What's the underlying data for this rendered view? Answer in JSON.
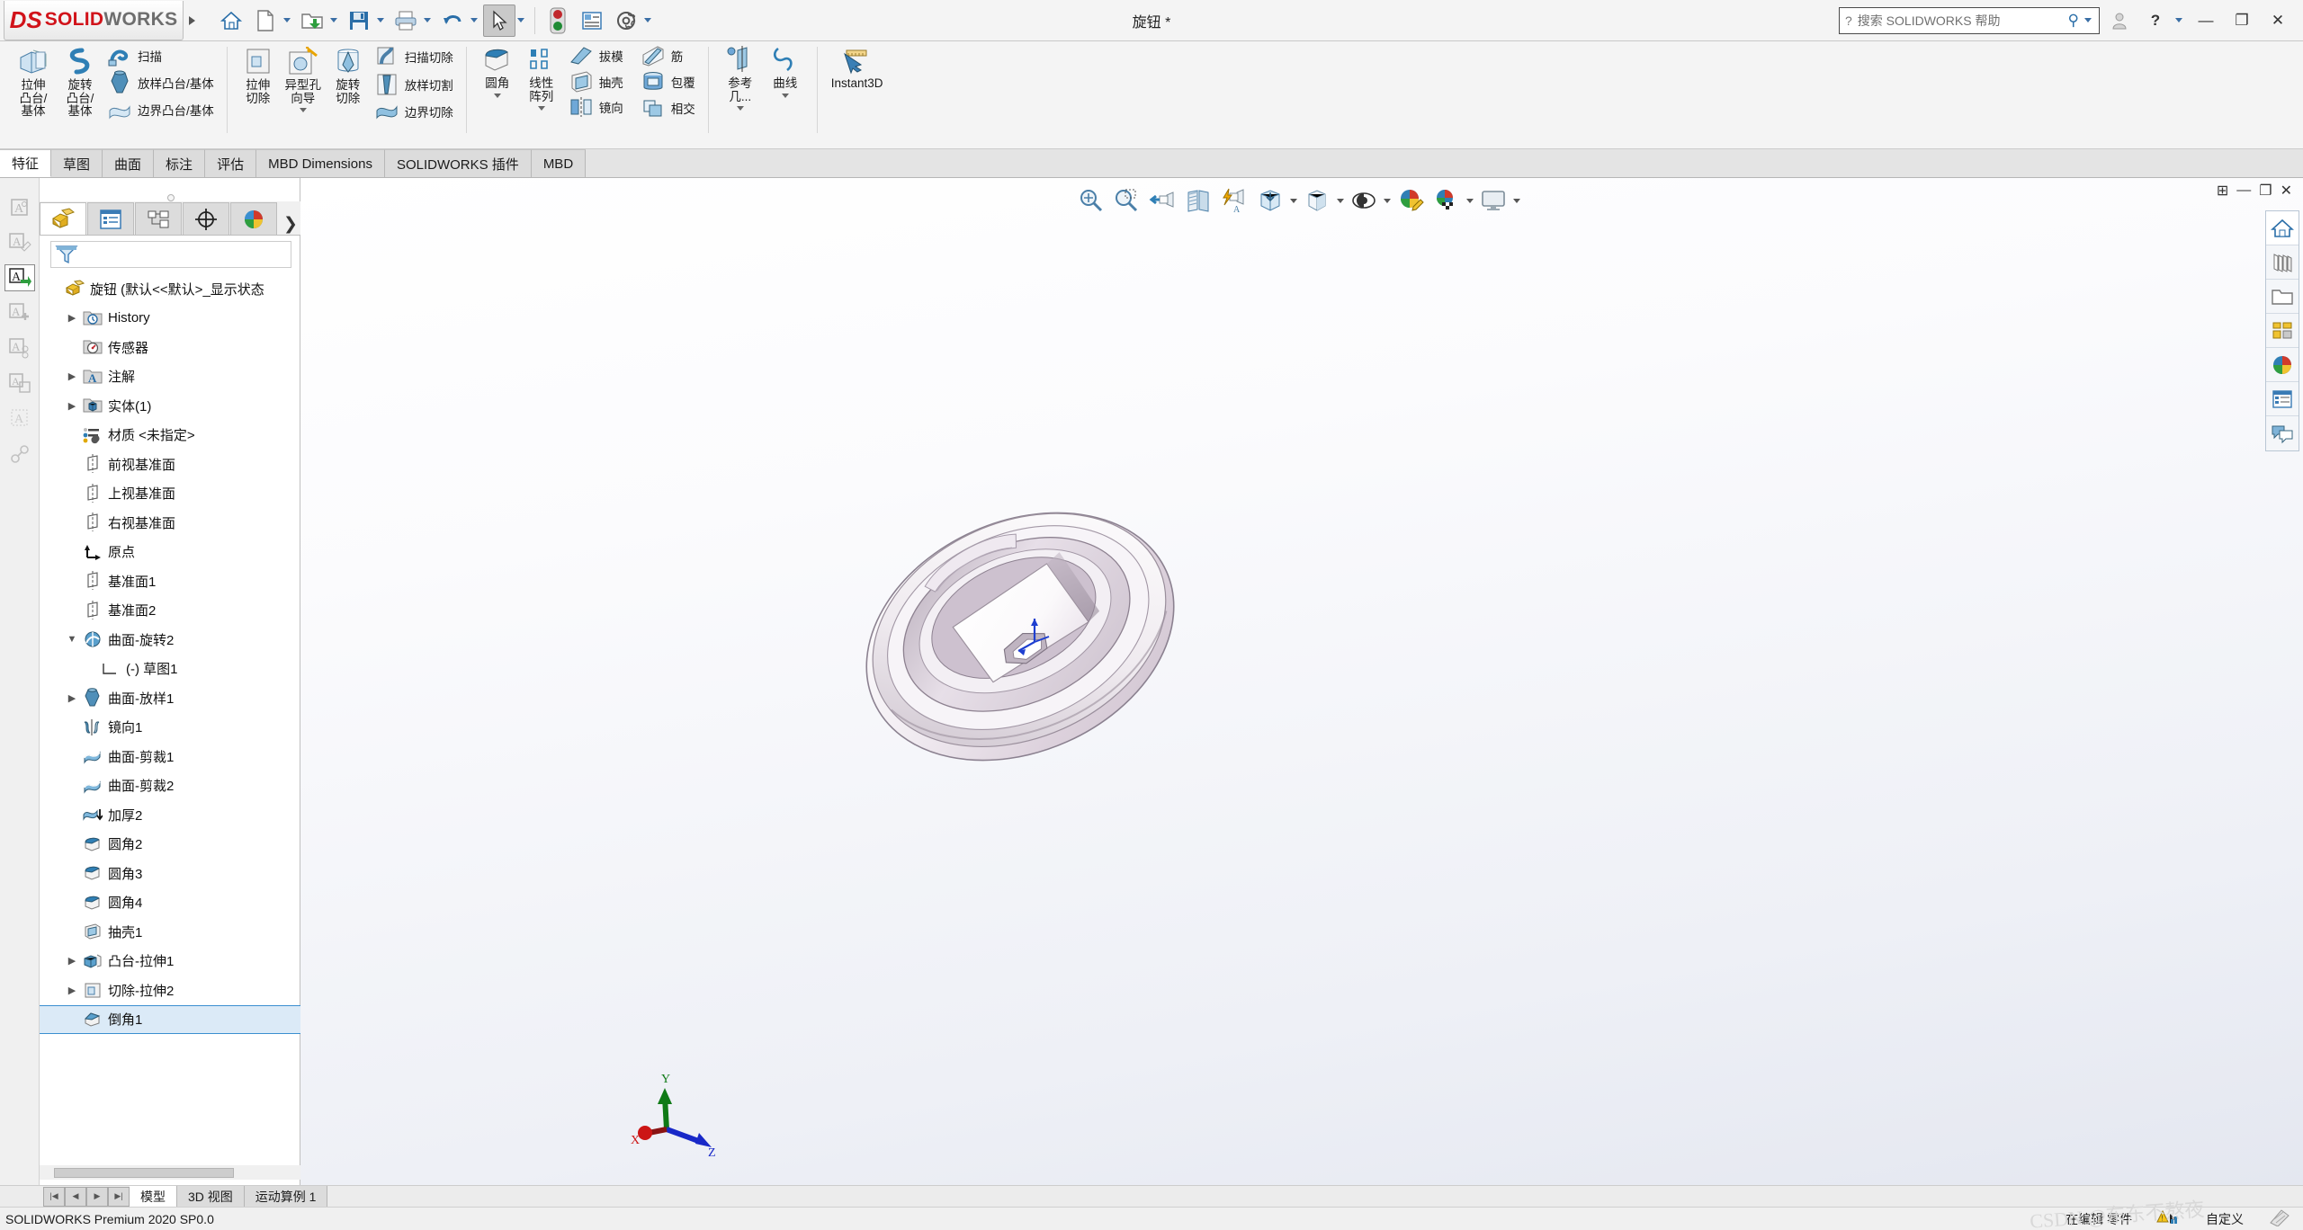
{
  "app": {
    "brand_ds": "DS",
    "brand_solid": "SOLID",
    "brand_works": "WORKS",
    "document_title": "旋钮 *",
    "status_version": "SOLIDWORKS Premium 2020 SP0.0",
    "accent_blue": "#2e78c4",
    "logo_red": "#d1131a"
  },
  "titlebar": {
    "search_placeholder": "搜索 SOLIDWORKS 帮助",
    "quick_access": [
      {
        "name": "home-icon",
        "label": "主页"
      },
      {
        "name": "new-document-icon",
        "label": "新建"
      },
      {
        "name": "open-document-icon",
        "label": "打开"
      },
      {
        "name": "save-icon",
        "label": "保存"
      },
      {
        "name": "print-icon",
        "label": "打印"
      },
      {
        "name": "undo-icon",
        "label": "撤销"
      },
      {
        "name": "select-icon",
        "label": "选择"
      },
      {
        "name": "rebuild-icon",
        "label": "重建模型"
      },
      {
        "name": "options-panel-icon",
        "label": "文件属性"
      },
      {
        "name": "gear-icon",
        "label": "选项"
      }
    ],
    "window_buttons": [
      "user-icon",
      "help-icon",
      "minimize",
      "restore",
      "close"
    ]
  },
  "ribbon": {
    "groups": [
      {
        "name": "features-group-1",
        "commands": [
          {
            "label": "拉伸\n凸台/\n基体",
            "icon": "extrude-boss-icon"
          },
          {
            "label": "旋转\n凸台/\n基体",
            "icon": "revolve-boss-icon"
          },
          {
            "label": "扫描",
            "icon": "sweep-icon",
            "row": true
          },
          {
            "label": "放样凸台/基体",
            "icon": "loft-boss-icon",
            "row": true
          },
          {
            "label": "边界凸台/基体",
            "icon": "boundary-boss-icon",
            "row": true
          }
        ]
      },
      {
        "name": "features-group-2",
        "commands": [
          {
            "label": "拉伸\n切除",
            "icon": "extrude-cut-icon"
          },
          {
            "label": "异型孔\n向导",
            "icon": "hole-wizard-icon"
          },
          {
            "label": "旋转\n切除",
            "icon": "revolve-cut-icon"
          },
          {
            "label": "扫描切除",
            "icon": "sweep-cut-icon",
            "row": true
          },
          {
            "label": "放样切割",
            "icon": "loft-cut-icon",
            "row": true
          },
          {
            "label": "边界切除",
            "icon": "boundary-cut-icon",
            "row": true
          }
        ]
      },
      {
        "name": "features-group-3",
        "commands": [
          {
            "label": "圆角",
            "icon": "fillet-icon"
          },
          {
            "label": "线性\n阵列",
            "icon": "linear-pattern-icon"
          },
          {
            "label": "拔模",
            "icon": "draft-icon",
            "row": true
          },
          {
            "label": "抽壳",
            "icon": "shell-icon",
            "row": true
          },
          {
            "label": "镜向",
            "icon": "mirror-icon",
            "row": true
          },
          {
            "label": "筋",
            "icon": "rib-icon",
            "row": true
          },
          {
            "label": "包覆",
            "icon": "wrap-icon",
            "row": true
          },
          {
            "label": "相交",
            "icon": "intersect-icon",
            "row": true
          }
        ]
      },
      {
        "name": "reference-group",
        "commands": [
          {
            "label": "参考\n几...",
            "icon": "reference-geometry-icon"
          },
          {
            "label": "曲线",
            "icon": "curves-icon"
          }
        ]
      },
      {
        "name": "instant3d-group",
        "commands": [
          {
            "label": "Instant3D",
            "icon": "instant3d-icon"
          }
        ]
      }
    ]
  },
  "tabs": [
    {
      "label": "特征",
      "selected": true
    },
    {
      "label": "草图",
      "selected": false
    },
    {
      "label": "曲面",
      "selected": false
    },
    {
      "label": "标注",
      "selected": false
    },
    {
      "label": "评估",
      "selected": false
    },
    {
      "label": "MBD Dimensions",
      "selected": false
    },
    {
      "label": "SOLIDWORKS 插件",
      "selected": false
    },
    {
      "label": "MBD",
      "selected": false
    }
  ],
  "left_rail": [
    {
      "name": "annotation-new-icon",
      "selected": false
    },
    {
      "name": "annotation-edit-icon",
      "selected": false
    },
    {
      "name": "annotation-insert-icon",
      "selected": true
    },
    {
      "name": "annotation-add-icon",
      "selected": false
    },
    {
      "name": "annotation-attach-icon",
      "selected": false
    },
    {
      "name": "annotation-save-icon",
      "selected": false
    },
    {
      "name": "annotation-pattern-icon",
      "selected": false
    },
    {
      "name": "annotation-link-icon",
      "selected": false
    }
  ],
  "feature_manager": {
    "tabs": [
      {
        "name": "feature-tree-tab",
        "icon": "feature-tree-icon",
        "selected": true
      },
      {
        "name": "property-manager-tab",
        "icon": "property-list-icon",
        "selected": false
      },
      {
        "name": "configuration-manager-tab",
        "icon": "configuration-icon",
        "selected": false
      },
      {
        "name": "dimxpert-manager-tab",
        "icon": "dimxpert-icon",
        "selected": false
      },
      {
        "name": "display-manager-tab",
        "icon": "display-sphere-icon",
        "selected": false
      }
    ],
    "chevron": "❯",
    "filter_placeholder": "",
    "tree": [
      {
        "label": "旋钮  (默认<<默认>_显示状态",
        "icon": "part-icon",
        "indent": 0,
        "twisty": "",
        "root": true
      },
      {
        "label": "History",
        "icon": "history-folder-icon",
        "indent": 1,
        "twisty": "▶"
      },
      {
        "label": "传感器",
        "icon": "sensors-folder-icon",
        "indent": 1,
        "twisty": ""
      },
      {
        "label": "注解",
        "icon": "annotations-folder-icon",
        "indent": 1,
        "twisty": "▶"
      },
      {
        "label": "实体(1)",
        "icon": "solid-bodies-folder-icon",
        "indent": 1,
        "twisty": "▶"
      },
      {
        "label": "材质 <未指定>",
        "icon": "material-icon",
        "indent": 1,
        "twisty": ""
      },
      {
        "label": "前视基准面",
        "icon": "plane-icon",
        "indent": 1,
        "twisty": ""
      },
      {
        "label": "上视基准面",
        "icon": "plane-icon",
        "indent": 1,
        "twisty": ""
      },
      {
        "label": "右视基准面",
        "icon": "plane-icon",
        "indent": 1,
        "twisty": ""
      },
      {
        "label": "原点",
        "icon": "origin-icon",
        "indent": 1,
        "twisty": ""
      },
      {
        "label": "基准面1",
        "icon": "plane-icon",
        "indent": 1,
        "twisty": ""
      },
      {
        "label": "基准面2",
        "icon": "plane-icon",
        "indent": 1,
        "twisty": ""
      },
      {
        "label": "曲面-旋转2",
        "icon": "surface-revolve-icon",
        "indent": 1,
        "twisty": "▼"
      },
      {
        "label": "(-) 草图1",
        "icon": "sketch-icon",
        "indent": 2,
        "twisty": ""
      },
      {
        "label": "曲面-放样1",
        "icon": "surface-loft-icon",
        "indent": 1,
        "twisty": "▶"
      },
      {
        "label": "镜向1",
        "icon": "mirror-feature-icon",
        "indent": 1,
        "twisty": ""
      },
      {
        "label": "曲面-剪裁1",
        "icon": "surface-trim-icon",
        "indent": 1,
        "twisty": ""
      },
      {
        "label": "曲面-剪裁2",
        "icon": "surface-trim-icon",
        "indent": 1,
        "twisty": ""
      },
      {
        "label": "加厚2",
        "icon": "thicken-icon",
        "indent": 1,
        "twisty": ""
      },
      {
        "label": "圆角2",
        "icon": "fillet-feature-icon",
        "indent": 1,
        "twisty": ""
      },
      {
        "label": "圆角3",
        "icon": "fillet-feature-icon",
        "indent": 1,
        "twisty": ""
      },
      {
        "label": "圆角4",
        "icon": "fillet-feature-icon",
        "indent": 1,
        "twisty": ""
      },
      {
        "label": "抽壳1",
        "icon": "shell-feature-icon",
        "indent": 1,
        "twisty": ""
      },
      {
        "label": "凸台-拉伸1",
        "icon": "boss-extrude-icon",
        "indent": 1,
        "twisty": "▶"
      },
      {
        "label": "切除-拉伸2",
        "icon": "cut-extrude-icon",
        "indent": 1,
        "twisty": "▶"
      },
      {
        "label": "倒角1",
        "icon": "chamfer-icon",
        "indent": 1,
        "twisty": "",
        "selected": true
      }
    ]
  },
  "view_toolbar": [
    {
      "name": "zoom-to-fit-icon"
    },
    {
      "name": "zoom-to-area-icon"
    },
    {
      "name": "previous-view-icon"
    },
    {
      "name": "section-view-icon"
    },
    {
      "name": "view-orientation-flash-icon"
    },
    {
      "name": "view-orientation-icon",
      "caret": true
    },
    {
      "name": "display-style-icon",
      "caret": true
    },
    {
      "name": "hide-show-items-icon",
      "caret": true
    },
    {
      "name": "edit-appearance-icon"
    },
    {
      "name": "apply-scene-icon",
      "caret": true
    },
    {
      "name": "view-settings-icon",
      "caret": true
    }
  ],
  "right_dock": [
    {
      "name": "home-dock-icon",
      "selected": true
    },
    {
      "name": "design-library-icon",
      "selected": false
    },
    {
      "name": "file-explorer-icon",
      "selected": false
    },
    {
      "name": "view-palette-icon",
      "selected": false
    },
    {
      "name": "appearances-scenes-icon",
      "selected": false
    },
    {
      "name": "custom-properties-icon",
      "selected": false
    },
    {
      "name": "forum-icon",
      "selected": false
    }
  ],
  "triad": {
    "x_label": "X",
    "y_label": "Y",
    "z_label": "Z"
  },
  "document_tabs": [
    {
      "label": "模型",
      "selected": true
    },
    {
      "label": "3D 视图",
      "selected": false
    },
    {
      "label": "运动算例 1",
      "selected": false
    }
  ],
  "statusbar": {
    "left": "SOLIDWORKS Premium 2020 SP0.0",
    "editing": "在编辑 零件",
    "custom": "自定义",
    "watermark": "CSDN @东东不熬夜"
  }
}
